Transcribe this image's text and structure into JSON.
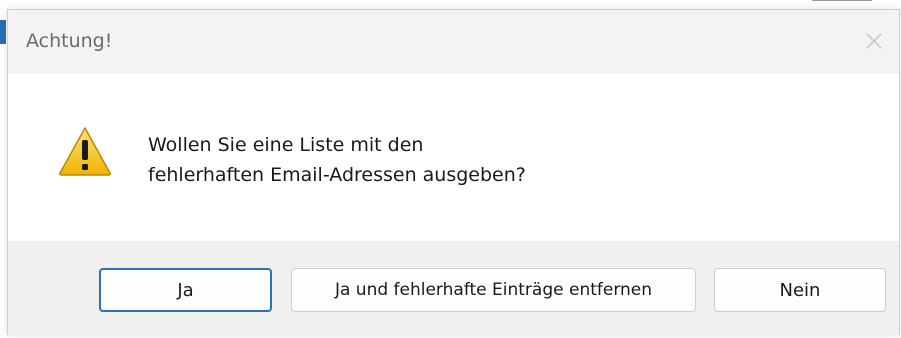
{
  "dialog": {
    "title": "Achtung!",
    "close_icon": "close-icon",
    "icon": "warning-icon",
    "message_line1": "Wollen Sie eine Liste mit den",
    "message_line2": "fehlerhaften Email-Adressen ausgeben?",
    "buttons": {
      "yes": "Ja",
      "yes_remove": "Ja und fehlerhafte Einträge entfernen",
      "no": "Nein"
    }
  },
  "colors": {
    "default_button_border": "#2f6fc0",
    "footer_background": "#f0f0f0",
    "titlebar_background": "#f3f3f3",
    "warning_yellow": "#f5c518"
  }
}
